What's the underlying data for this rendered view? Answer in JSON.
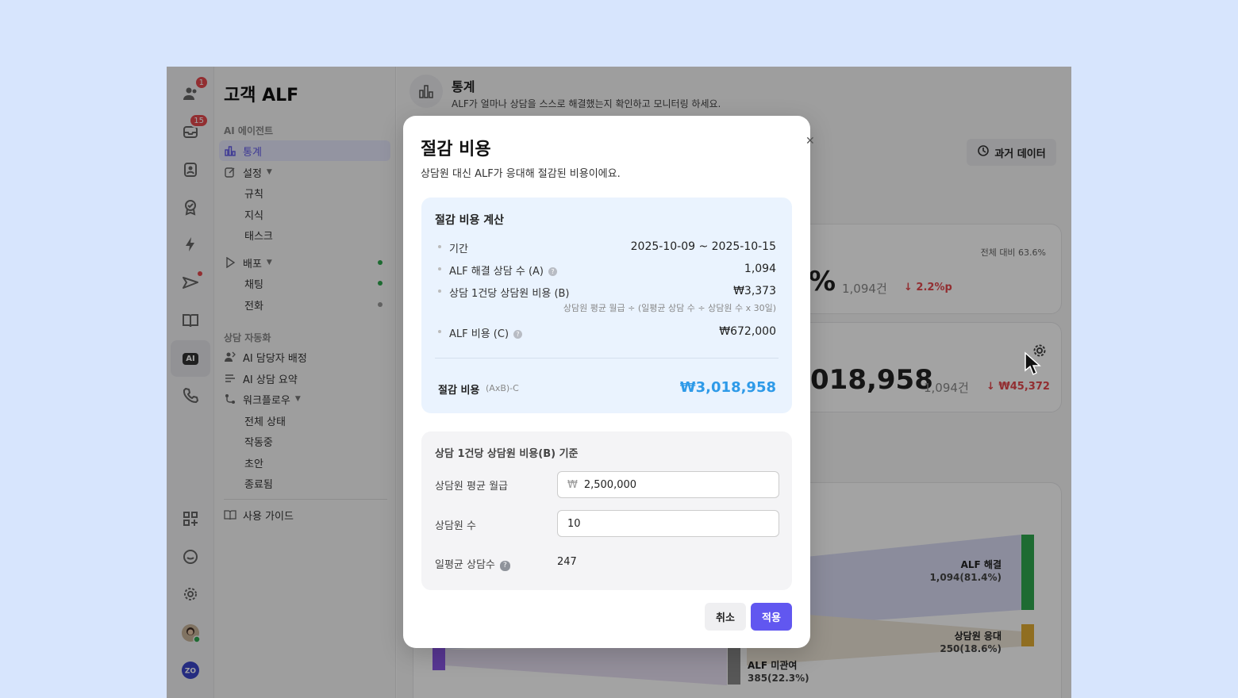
{
  "rail": {
    "badge_users": "1",
    "badge_inbox": "15",
    "ai_label": "AI"
  },
  "nav": {
    "title": "고객 ALF",
    "section_ai": "AI 에이전트",
    "stats": "통계",
    "settings": "설정",
    "rules": "규칙",
    "knowledge": "지식",
    "tasks": "태스크",
    "deploy": "배포",
    "chat": "채팅",
    "phone": "전화",
    "section_auto": "상담 자동화",
    "ai_assign": "AI 담당자 배정",
    "ai_summary": "AI 상담 요약",
    "workflow": "워크플로우",
    "wf_all": "전체 상태",
    "wf_running": "작동중",
    "wf_draft": "초안",
    "wf_ended": "종료됨",
    "guide": "사용 가이드"
  },
  "header": {
    "title": "통계",
    "subtitle": "ALF가 얼마나 상담을 스스로 해결했는지 확인하고 모니터링 하세요.",
    "past_data": "과거 데이터"
  },
  "bg": {
    "card1_compare": "전체 대비 63.6%",
    "card1_pct": "%",
    "card1_count": "1,094건",
    "card1_delta": "2.2%p",
    "card2_value": "018,958",
    "card2_count": "1,094건",
    "card2_delta": "₩45,372",
    "sankey_resolved": "ALF 해결",
    "sankey_resolved_v": "1,094(81.4%)",
    "sankey_agent": "상담원 응대",
    "sankey_agent_v": "250(18.6%)",
    "sankey_none": "ALF 미관여",
    "sankey_none_v": "385(22.3%)"
  },
  "modal": {
    "title": "절감 비용",
    "subtitle": "상담원 대신 ALF가 응대해 절감된 비용이에요.",
    "calc_title": "절감 비용 계산",
    "period_label": "기간",
    "period_value": "2025-10-09 ~ 2025-10-15",
    "resolved_label": "ALF 해결 상담 수 (A)",
    "resolved_value": "1,094",
    "cost_label": "상담 1건당 상담원 비용 (B)",
    "cost_value": "₩3,373",
    "cost_note": "상담원 평균 월급 ÷ (일평균 상담 수 ÷ 상담원 수 x 30일)",
    "alf_label": "ALF 비용 (C)",
    "alf_value": "₩672,000",
    "total_label": "절감 비용",
    "total_formula": "(AxB)-C",
    "total_value": "₩3,018,958",
    "basis_title": "상담 1건당 상담원 비용(B) 기준",
    "salary_label": "상담원 평균 월급",
    "currency": "₩",
    "salary_value": "2,500,000",
    "agents_label": "상담원 수",
    "agents_value": "10",
    "daily_label": "일평균 상담수",
    "daily_value": "247",
    "cancel": "취소",
    "apply": "적용"
  }
}
